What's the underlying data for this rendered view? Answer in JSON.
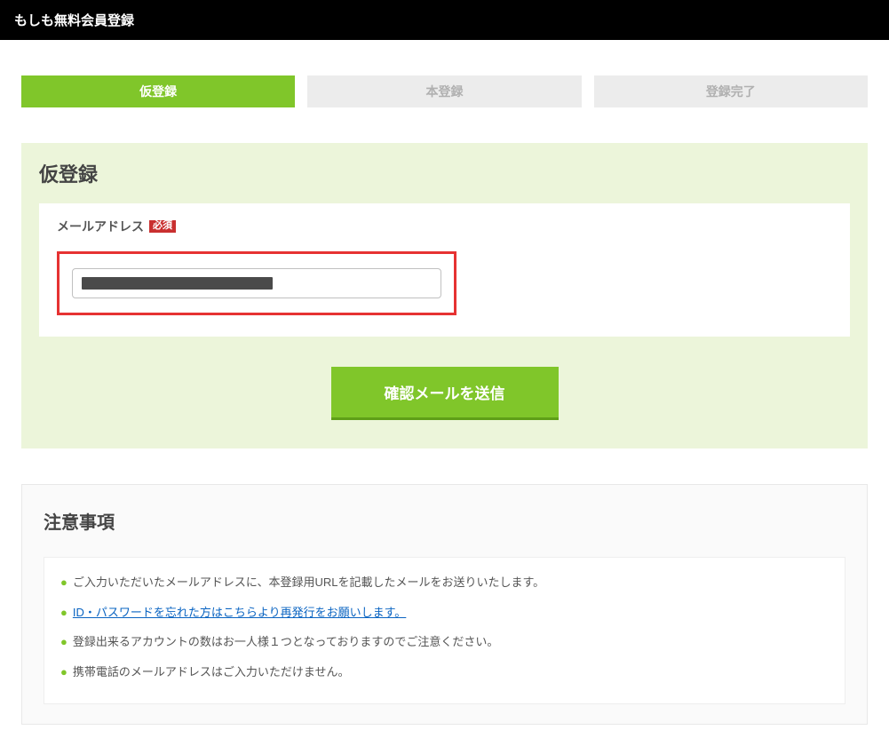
{
  "header": {
    "title": "もしも無料会員登録"
  },
  "steps": {
    "tab1": "仮登録",
    "tab2": "本登録",
    "tab3": "登録完了"
  },
  "panel": {
    "title": "仮登録",
    "field_label": "メールアドレス",
    "required_label": "必須",
    "submit_label": "確認メールを送信"
  },
  "notes": {
    "title": "注意事項",
    "items": [
      "ご入力いただいたメールアドレスに、本登録用URLを記載したメールをお送りいたします。",
      "ID・パスワードを忘れた方はこちらより再発行をお願いします。",
      "登録出来るアカウントの数はお一人様１つとなっておりますのでご注意ください。",
      "携帯電話のメールアドレスはご入力いただけません。"
    ]
  }
}
